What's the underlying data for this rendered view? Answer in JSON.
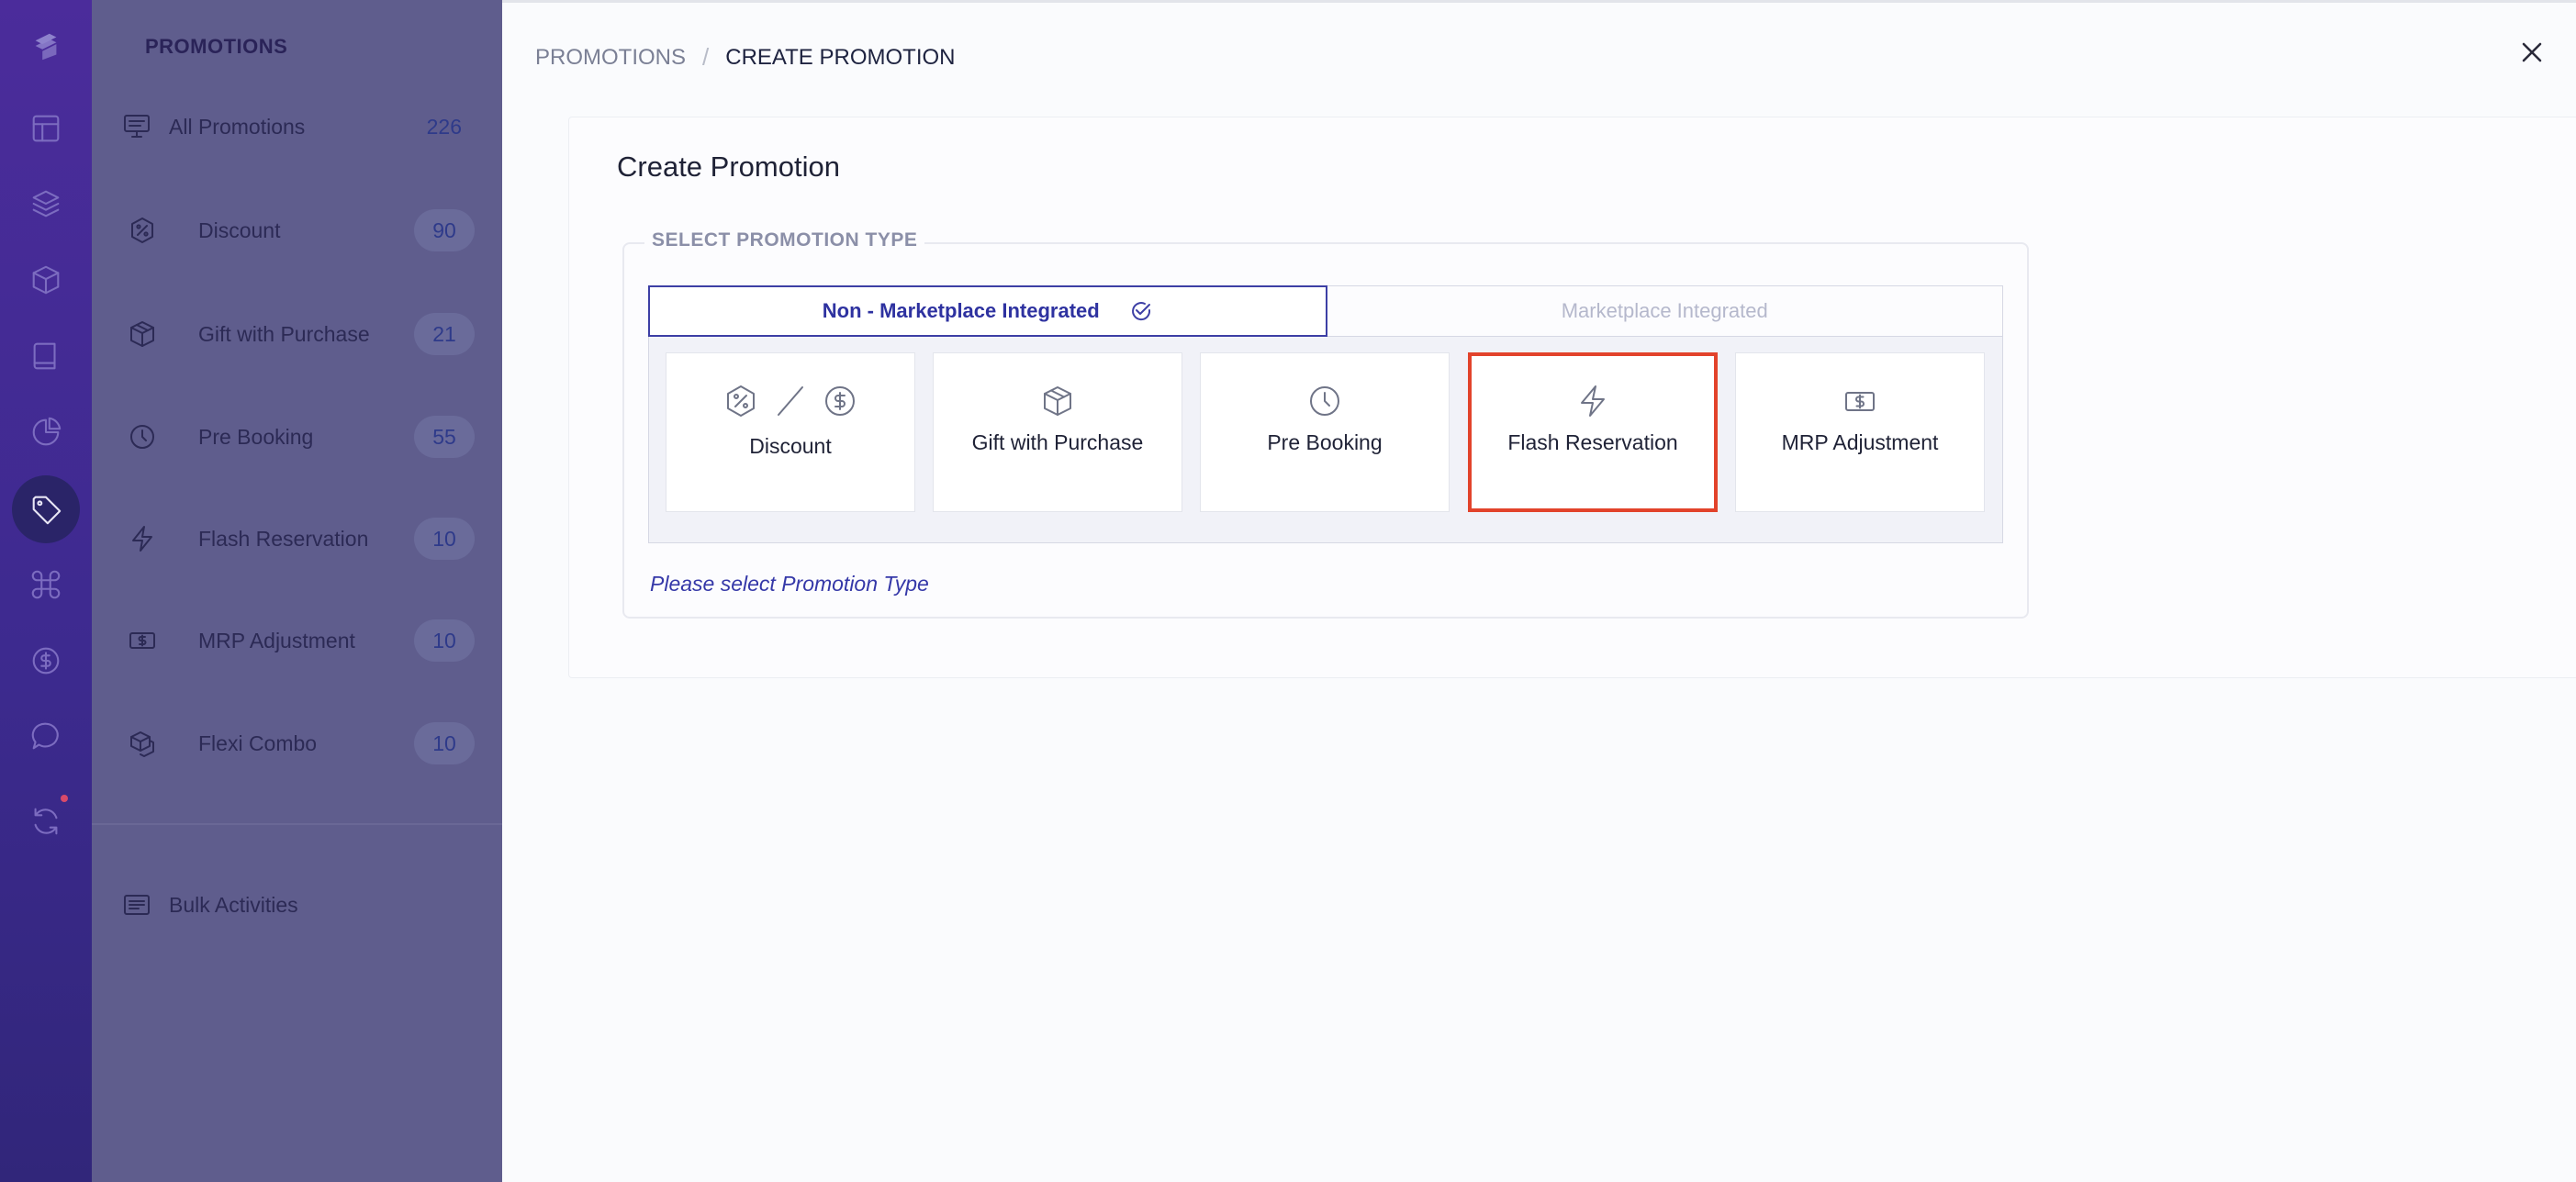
{
  "sidebar": {
    "title": "PROMOTIONS",
    "items": [
      {
        "label": "All Promotions",
        "count": "226",
        "icon": "monitor-icon"
      },
      {
        "label": "Discount",
        "count": "90",
        "icon": "discount-badge-icon"
      },
      {
        "label": "Gift with Purchase",
        "count": "21",
        "icon": "box-icon"
      },
      {
        "label": "Pre Booking",
        "count": "55",
        "icon": "clock-icon"
      },
      {
        "label": "Flash Reservation",
        "count": "10",
        "icon": "lightning-icon"
      },
      {
        "label": "MRP Adjustment",
        "count": "10",
        "icon": "banknote-icon"
      },
      {
        "label": "Flexi Combo",
        "count": "10",
        "icon": "boxes-icon"
      }
    ],
    "bulk": {
      "label": "Bulk Activities",
      "icon": "list-icon"
    }
  },
  "breadcrumb": {
    "parent": "PROMOTIONS",
    "separator": "/",
    "current": "CREATE PROMOTION"
  },
  "card": {
    "title": "Create Promotion",
    "section_legend": "SELECT PROMOTION TYPE",
    "tabs": [
      {
        "label": "Non - Marketplace Integrated",
        "active": true
      },
      {
        "label": "Marketplace Integrated",
        "active": false
      }
    ],
    "types": [
      {
        "label": "Discount",
        "icon": "discount-icon"
      },
      {
        "label": "Gift with Purchase",
        "icon": "box-icon"
      },
      {
        "label": "Pre Booking",
        "icon": "clock-icon"
      },
      {
        "label": "Flash Reservation",
        "icon": "lightning-icon",
        "highlighted": true
      },
      {
        "label": "MRP Adjustment",
        "icon": "banknote-icon"
      }
    ],
    "hint": "Please select Promotion Type"
  },
  "colors": {
    "rail": "#3d2a8f",
    "sidebar": "#5f5d8d",
    "accent": "#3d3fa5",
    "highlight": "#e2432b"
  }
}
